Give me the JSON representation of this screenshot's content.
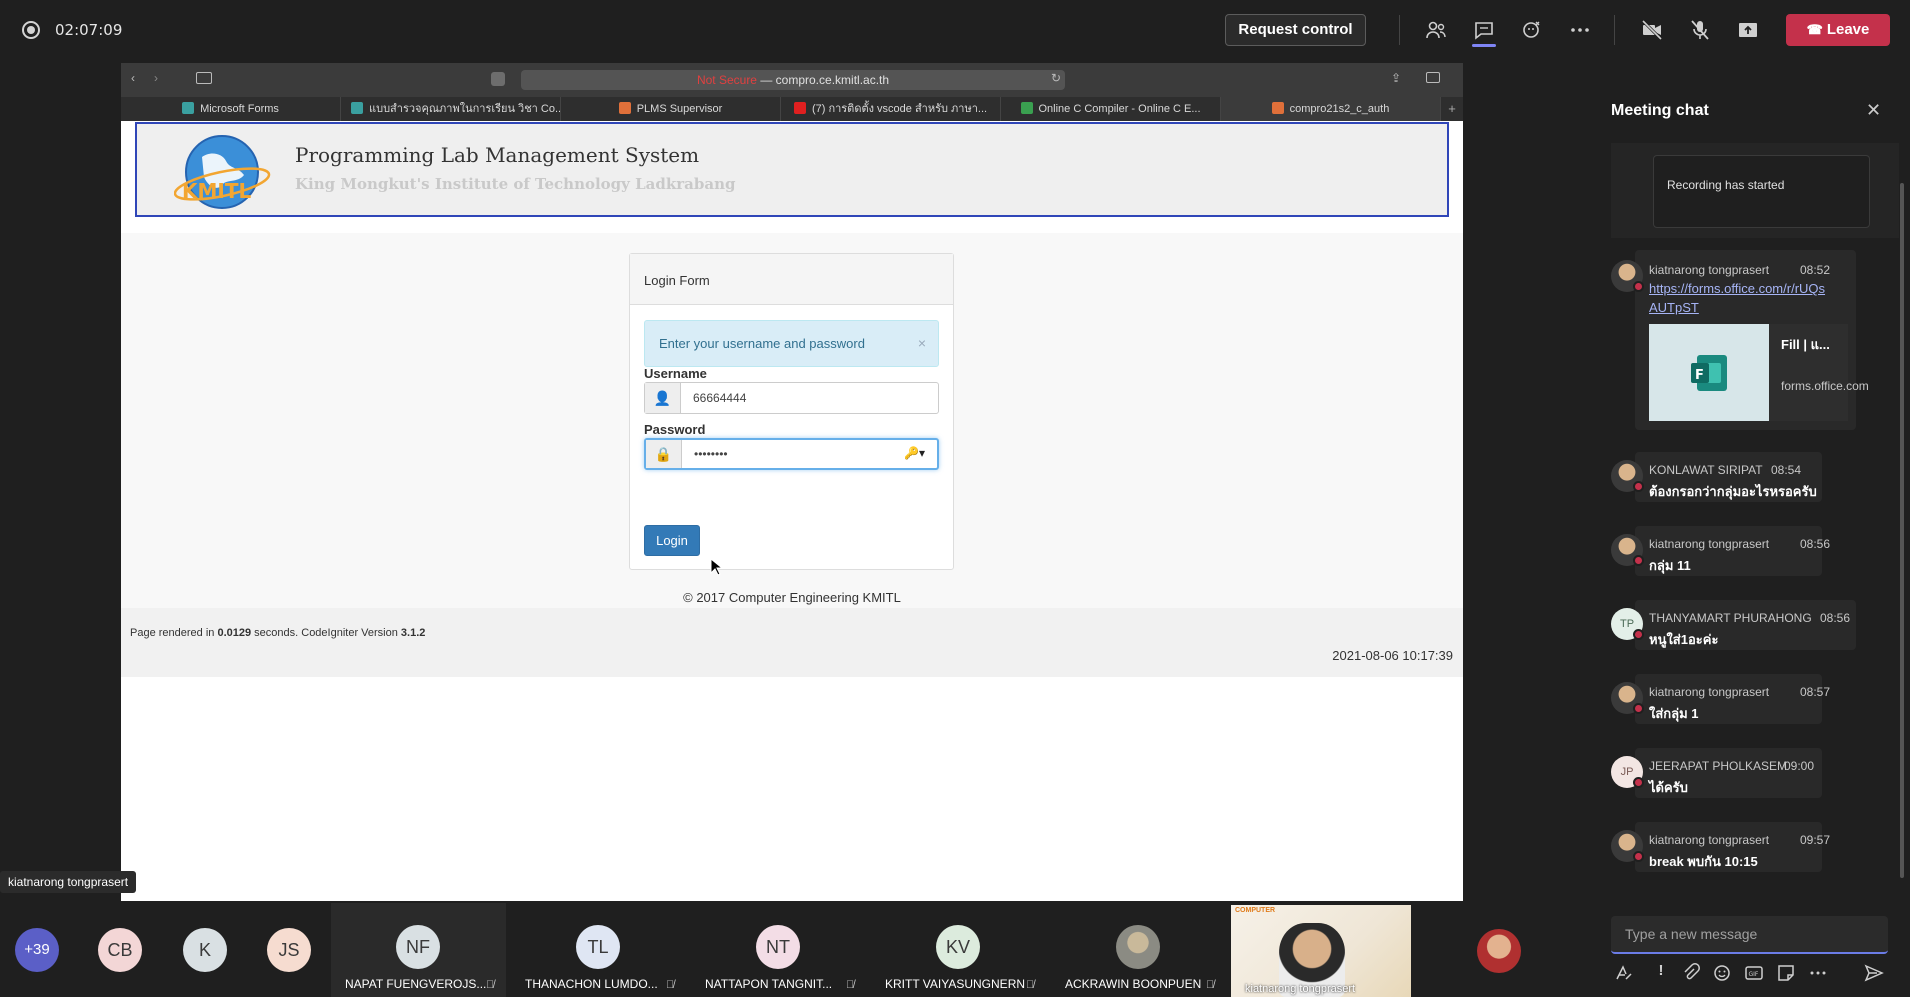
{
  "meeting": {
    "timer": "02:07:09",
    "request_control": "Request control",
    "leave": "Leave",
    "presenter_name": "kiatnarong tongprasert"
  },
  "browser": {
    "address_not_secure": "Not Secure",
    "address_domain": "compro.ce.kmitl.ac.th",
    "tabs": [
      {
        "label": "Microsoft Forms",
        "color": "#3aa0a0"
      },
      {
        "label": "แบบสำรวจคุณภาพในการเรียน วิชา Co...",
        "color": "#3aa0a0"
      },
      {
        "label": "PLMS Supervisor",
        "color": "#e0703a"
      },
      {
        "label": "(7) การติดตั้ง vscode สำหรับ ภาษา...",
        "color": "#e02020"
      },
      {
        "label": "Online C Compiler - Online C E...",
        "color": "#3aa050"
      },
      {
        "label": "compro21s2_c_auth",
        "color": "#e0703a"
      }
    ]
  },
  "plms": {
    "title": "Programming Lab Management System",
    "subtitle": "King Mongkut's Institute of Technology Ladkrabang",
    "logo_text": "KMITL",
    "login_heading": "Login Form",
    "alert": "Enter your username and password",
    "alert_close": "×",
    "username_label": "Username",
    "username_value": "66664444",
    "password_label": "Password",
    "password_value": "••••••••",
    "login_button": "Login",
    "copyright": "© 2017 Computer Engineering KMITL",
    "render_info_prefix": "Page rendered in ",
    "render_info_time": "0.0129",
    "render_info_mid": " seconds. CodeIgniter Version ",
    "render_info_version": "3.1.2",
    "timestamp": "2021-08-06 10:17:39"
  },
  "chat": {
    "title": "Meeting chat",
    "recording_notice": "Recording has started",
    "compose_placeholder": "Type a new message",
    "link_card": {
      "title": "Fill | แ...",
      "domain": "forms.office.com"
    },
    "messages": [
      {
        "name": "kiatnarong tongprasert",
        "time": "08:52",
        "text": "https://forms.office.com/r/rUQsAUTpST",
        "avatar": "photo"
      },
      {
        "name": "KONLAWAT SIRIPAT",
        "time": "08:54",
        "text": "ต้องกรอกว่ากลุ่มอะไรหรอครับ",
        "avatar": "photo"
      },
      {
        "name": "kiatnarong tongprasert",
        "time": "08:56",
        "text": "กลุ่ม 11",
        "avatar": "photo"
      },
      {
        "name": "THANYAMART PHURAHONG",
        "time": "08:56",
        "text": "หนูใส่1อะค่ะ",
        "avatar": "TP"
      },
      {
        "name": "kiatnarong tongprasert",
        "time": "08:57",
        "text": "ใส่กลุ่ม 1",
        "avatar": "photo"
      },
      {
        "name": "JEERAPAT PHOLKASEM",
        "time": "09:00",
        "text": "ได้ครับ",
        "avatar": "JP"
      },
      {
        "name": "kiatnarong tongprasert",
        "time": "09:57",
        "text": "break พบกัน 10:15",
        "avatar": "photo"
      }
    ]
  },
  "participants": {
    "overflow": "+39",
    "small": [
      {
        "initials": "CB",
        "color": "#f3d6d6"
      },
      {
        "initials": "K",
        "color": "#d9e0e3"
      },
      {
        "initials": "JS",
        "color": "#f6dcd0"
      }
    ],
    "tiles": [
      {
        "initials": "NF",
        "name": "NAPAT FUENGVEROJS...",
        "color": "#d9e0e3"
      },
      {
        "initials": "TL",
        "name": "THANACHON LUMDO...",
        "color": "#dfe6f3"
      },
      {
        "initials": "NT",
        "name": "NATTAPON TANGNIT...",
        "color": "#f3dde6"
      },
      {
        "initials": "KV",
        "name": "KRITT VAIYASUNGNERN",
        "color": "#dcebdd"
      },
      {
        "initials": "",
        "name": "ACKRAWIN BOONPUEN",
        "color": "#c9c0b4"
      }
    ],
    "video_label": "kiatnarong tongprasert"
  }
}
